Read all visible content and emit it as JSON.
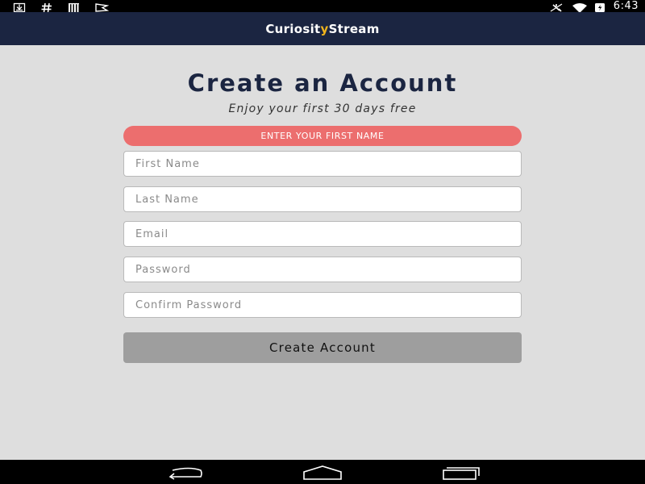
{
  "status_bar": {
    "time": "6:43",
    "left_icons": [
      "download-icon",
      "hash-icon",
      "barcode-icon",
      "flag-icon"
    ],
    "right_icons": [
      "airplane-mode-icon",
      "wifi-icon",
      "battery-icon"
    ]
  },
  "header": {
    "logo_part1": "Curiosit",
    "logo_accent": "y",
    "logo_part2": "Stream",
    "accent_color": "#f0b41c",
    "background_color": "#1b2541"
  },
  "form": {
    "title": "Create an Account",
    "subtitle": "Enjoy your first 30 days free",
    "error_message": "ENTER YOUR FIRST NAME",
    "error_color": "#ec6e6e",
    "fields": {
      "first_name": {
        "placeholder": "First Name",
        "value": ""
      },
      "last_name": {
        "placeholder": "Last Name",
        "value": ""
      },
      "email": {
        "placeholder": "Email",
        "value": ""
      },
      "password": {
        "placeholder": "Password",
        "value": ""
      },
      "confirm_password": {
        "placeholder": "Confirm Password",
        "value": ""
      }
    },
    "submit_label": "Create Account"
  },
  "nav_bar": {
    "buttons": [
      "back-icon",
      "home-icon",
      "recents-icon"
    ]
  }
}
